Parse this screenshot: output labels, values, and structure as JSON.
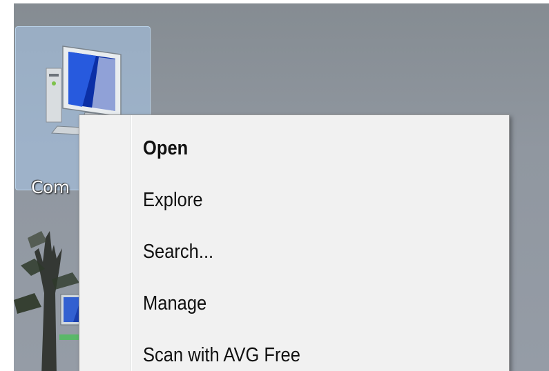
{
  "desktop": {
    "icon_label": "Com",
    "colors": {
      "desktop_bg": "#9097a0",
      "selection": "#aac8eb",
      "menu_bg": "#f1f1f1"
    }
  },
  "context_menu": {
    "items": [
      {
        "label": "Open",
        "default": true
      },
      {
        "label": "Explore",
        "default": false
      },
      {
        "label": "Search...",
        "default": false
      },
      {
        "label": "Manage",
        "default": false
      },
      {
        "label": "Scan with AVG Free",
        "default": false
      }
    ]
  }
}
